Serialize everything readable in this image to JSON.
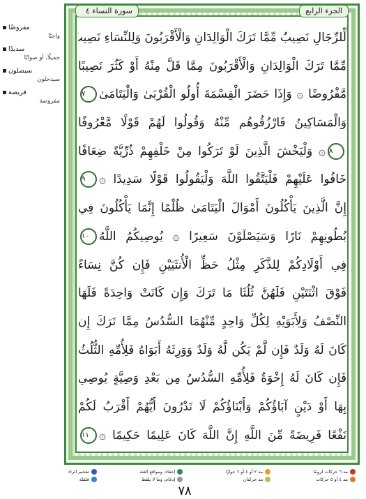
{
  "header": {
    "juz_label": "الجزء الرابع",
    "surah_label": "سورة النساء",
    "surah_number": "٤"
  },
  "lines": [
    "لِّلرِّجَالِ نَصِيبٌ مِّمَّا تَرَكَ الْوَالِدَانِ وَالْأَقْرَبُونَ وَلِلنِّسَاءِ نَصِيبٌ",
    "مِّمَّا تَرَكَ الْوَالِدَانِ وَالْأَقْرَبُونَ مِمَّا قَلَّ مِنْهُ أَوْ كَثُرَ نَصِيبًا",
    "مَّفْرُوضًا ۞ وَإِذَا حَضَرَ الْقِسْمَةَ أُولُو الْقُرْبَىٰ وَالْيَتَامَىٰ",
    "وَالْمَسَاكِينُ فَارْزُقُوهُم مِّنْهُ وَقُولُوا لَهُمْ قَوْلًا مَّعْرُوفًا",
    "۞ وَلْيَخْشَ الَّذِينَ لَوْ تَرَكُوا مِنْ خَلْفِهِمْ ذُرِّيَّةً ضِعَافًا",
    "خَافُوا عَلَيْهِمْ فَلْيَتَّقُوا اللَّهَ وَلْيَقُولُوا قَوْلًا سَدِيدًا ۞",
    "إِنَّ الَّذِينَ يَأْكُلُونَ أَمْوَالَ الْيَتَامَىٰ ظُلْمًا إِنَّمَا يَأْكُلُونَ فِي",
    "بُطُونِهِمْ نَارًا وَسَيَصْلَوْنَ سَعِيرًا ۞ يُوصِيكُمُ اللَّهُ",
    "فِي أَوْلَادِكُمْ لِلذَّكَرِ مِثْلُ حَظِّ الْأُنثَيَيْنِ فَإِن كُنَّ نِسَاءً",
    "فَوْقَ اثْنَتَيْنِ فَلَهُنَّ ثُلُثَا مَا تَرَكَ وَإِن كَانَتْ وَاحِدَةً فَلَهَا",
    "النِّصْفُ وَلِأَبَوَيْهِ لِكُلِّ وَاحِدٍ مِّنْهُمَا السُّدُسُ مِمَّا تَرَكَ إِن",
    "كَانَ لَهُ وَلَدٌ فَإِن لَّمْ يَكُن لَّهُ وَلَدٌ وَوَرِثَهُ أَبَوَاهُ فَلِأُمِّهِ الثُّلُثُ",
    "فَإِن كَانَ لَهُ إِخْوَةٌ فَلِأُمِّهِ السُّدُسُ مِن بَعْدِ وَصِيَّةٍ يُوصِي",
    "بِهَا أَوْ دَيْنٍ آبَاؤُكُمْ وَأَبْنَاؤُكُمْ لَا تَدْرُونَ أَيُّهُمْ أَقْرَبُ لَكُمْ",
    "نَفْعًا فَرِيضَةً مِّنَ اللَّهِ إِنَّ اللَّهَ كَانَ عَلِيمًا حَكِيمًا ۞"
  ],
  "ayah_markers": {
    "m7": "٧",
    "m8": "٨",
    "m9": "٩",
    "m10": "١٠",
    "m11": "١١"
  },
  "notes": [
    {
      "word": "مفروضًا",
      "gloss": "واجبًا"
    },
    {
      "word": "سديدًا",
      "gloss": "جميلًا، أو صوابًا"
    },
    {
      "word": "سيصلون",
      "gloss": "سيدخلون"
    },
    {
      "word": "فريضة",
      "gloss": "مفروضة"
    }
  ],
  "legend": {
    "right": [
      {
        "label": "مد ٦ حركات لزومًا",
        "color": "#c0392b"
      },
      {
        "label": "مد ٤ أو ٥ حركات",
        "color": "#e07a2e"
      }
    ],
    "mid_right": [
      {
        "label": "مد ٢ أو ٤ أو ٦ جوازًا",
        "color": "#d9a53a"
      },
      {
        "label": "مد حركتان",
        "color": "#c9b458"
      }
    ],
    "mid_left": [
      {
        "label": "إخفاء، ومواقع الغنة",
        "color": "#2e8b57"
      },
      {
        "label": "إدغام، وما لا يلفظ",
        "color": "#9a9a9a"
      }
    ],
    "left": [
      {
        "label": "تفخيم الراء",
        "color": "#2f5fa8"
      },
      {
        "label": "قلقلة",
        "color": "#3e7fd0"
      }
    ]
  },
  "page_number": "٧٨"
}
